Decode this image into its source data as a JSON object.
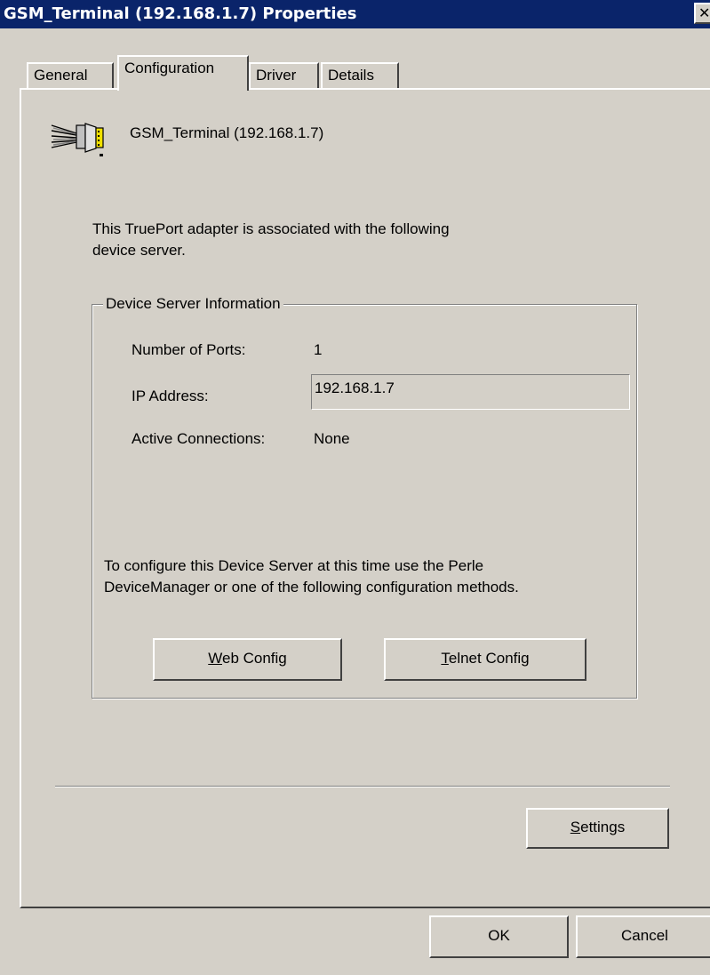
{
  "window": {
    "title": "GSM_Terminal (192.168.1.7) Properties",
    "close_glyph": "✕"
  },
  "tabs": [
    {
      "label": "General",
      "active": false
    },
    {
      "label": "Configuration",
      "active": true
    },
    {
      "label": "Driver",
      "active": false
    },
    {
      "label": "Details",
      "active": false
    }
  ],
  "device": {
    "icon": "serial-port-icon",
    "name": "GSM_Terminal (192.168.1.7)"
  },
  "intro": {
    "line1": "This TruePort adapter is associated with the following",
    "line2": "device server."
  },
  "device_server_info": {
    "legend": "Device Server Information",
    "ports_label": "Number of Ports:",
    "ports_value": "1",
    "ip_label": "IP Address:",
    "ip_value": "192.168.1.7",
    "connections_label": "Active Connections:",
    "connections_value": "None",
    "config_line1": "To configure this Device Server at this time use the Perle",
    "config_line2": "DeviceManager or one of the following configuration methods.",
    "web_button": {
      "mnemonic": "W",
      "rest": "eb Config"
    },
    "telnet_button": {
      "mnemonic": "T",
      "rest": "elnet Config"
    }
  },
  "settings_button": {
    "mnemonic": "S",
    "rest": "ettings"
  },
  "footer": {
    "ok_label": "OK",
    "cancel_label": "Cancel"
  },
  "colors": {
    "titlebar": "#0a246a",
    "face": "#d4d0c8"
  }
}
